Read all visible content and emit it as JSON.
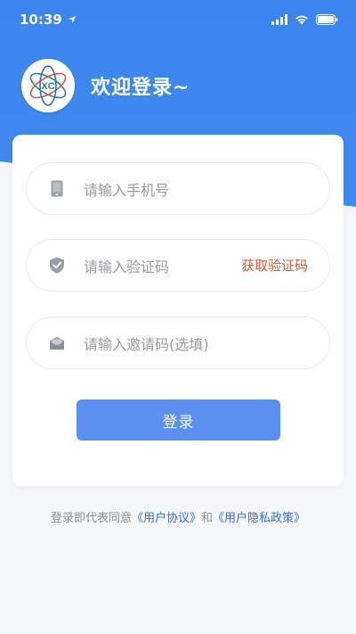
{
  "status_bar": {
    "time": "10:39"
  },
  "header": {
    "welcome": "欢迎登录~",
    "logo_text": "XC"
  },
  "form": {
    "phone_placeholder": "请输入手机号",
    "code_placeholder": "请输入验证码",
    "get_code_label": "获取验证码",
    "invite_placeholder": "请输入邀请码(选填)",
    "login_label": "登录"
  },
  "agreement": {
    "prefix": "登录即代表同意",
    "user_agreement": "《用户协议》",
    "conjunction": "和",
    "privacy_policy": "《用户隐私政策》"
  },
  "colors": {
    "primary": "#3a86ee",
    "button": "#5b8ff0",
    "accent": "#e8562a"
  }
}
